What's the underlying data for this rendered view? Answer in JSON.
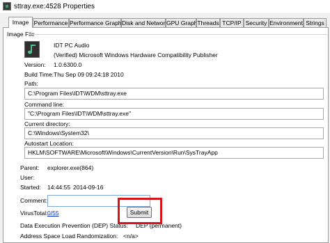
{
  "window": {
    "title": "sttray.exe:4528 Properties"
  },
  "tabs": [
    {
      "label": "Image"
    },
    {
      "label": "Performance"
    },
    {
      "label": "Performance Graph"
    },
    {
      "label": "Disk and Network"
    },
    {
      "label": "GPU Graph"
    },
    {
      "label": "Threads"
    },
    {
      "label": "TCP/IP"
    },
    {
      "label": "Security"
    },
    {
      "label": "Environment"
    },
    {
      "label": "Strings"
    }
  ],
  "image_file": {
    "group_label": "Image File",
    "description": "IDT PC Audio",
    "publisher": "(Verified) Microsoft Windows Hardware Compatibility Publisher",
    "version_label": "Version:",
    "version": "1.0.6300.0",
    "build_time_label": "Build Time:",
    "build_time": "Thu Sep 09 09:24:18 2010",
    "path_label": "Path:",
    "path": "C:\\Program Files\\IDT\\WDM\\sttray.exe",
    "command_line_label": "Command line:",
    "command_line": "\"C:\\Program Files\\IDT\\WDM\\sttray.exe\"",
    "current_directory_label": "Current directory:",
    "current_directory": "C:\\Windows\\System32\\",
    "autostart_label": "Autostart Location:",
    "autostart": "HKLM\\SOFTWARE\\Microsoft\\Windows\\CurrentVersion\\Run\\SysTrayApp"
  },
  "process": {
    "parent_label": "Parent:",
    "parent": "explorer.exe(864)",
    "user_label": "User:",
    "user": "",
    "started_label": "Started:",
    "started_time": "14:44:55",
    "started_date": "2014-09-16",
    "comment_label": "Comment:",
    "comment": "",
    "virustotal_label": "VirusTotal:",
    "virustotal_link": "0/55",
    "submit_label": "Submit",
    "dep_label": "Data Execution Prevention (DEP) Status:",
    "dep_value": "DEP (permanent)",
    "aslr_label": "Address Space Load Randomization:",
    "aslr_value": "<n/a>"
  },
  "colors": {
    "highlight": "#d8141b",
    "link": "#0033cc"
  }
}
